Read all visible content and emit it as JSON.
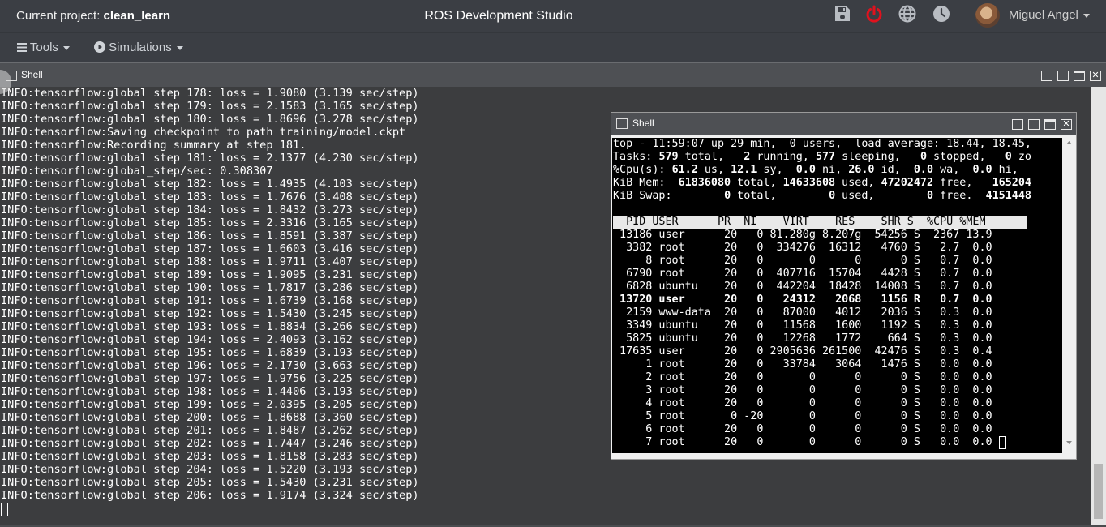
{
  "navbar": {
    "project_label": "Current project:",
    "project_name": "clean_learn",
    "title": "ROS Development Studio",
    "icons": [
      "save-icon",
      "power-icon",
      "globe-icon",
      "clock-icon"
    ],
    "user_name": "Miguel Angel",
    "power_color": "#e0121e"
  },
  "toolbar": {
    "tools_label": "Tools",
    "simulations_label": "Simulations"
  },
  "shell": {
    "title": "Shell",
    "log": "INFO:tensorflow:global step 178: loss = 1.9080 (3.139 sec/step)\nINFO:tensorflow:global step 179: loss = 2.1583 (3.165 sec/step)\nINFO:tensorflow:global step 180: loss = 1.8696 (3.278 sec/step)\nINFO:tensorflow:Saving checkpoint to path training/model.ckpt\nINFO:tensorflow:Recording summary at step 181.\nINFO:tensorflow:global step 181: loss = 2.1377 (4.230 sec/step)\nINFO:tensorflow:global_step/sec: 0.308307\nINFO:tensorflow:global step 182: loss = 1.4935 (4.103 sec/step)\nINFO:tensorflow:global step 183: loss = 1.7676 (3.408 sec/step)\nINFO:tensorflow:global step 184: loss = 1.8432 (3.273 sec/step)\nINFO:tensorflow:global step 185: loss = 2.3316 (3.165 sec/step)\nINFO:tensorflow:global step 186: loss = 1.8591 (3.387 sec/step)\nINFO:tensorflow:global step 187: loss = 1.6603 (3.416 sec/step)\nINFO:tensorflow:global step 188: loss = 1.9711 (3.407 sec/step)\nINFO:tensorflow:global step 189: loss = 1.9095 (3.231 sec/step)\nINFO:tensorflow:global step 190: loss = 1.7817 (3.286 sec/step)\nINFO:tensorflow:global step 191: loss = 1.6739 (3.168 sec/step)\nINFO:tensorflow:global step 192: loss = 1.5430 (3.245 sec/step)\nINFO:tensorflow:global step 193: loss = 1.8834 (3.266 sec/step)\nINFO:tensorflow:global step 194: loss = 2.4093 (3.162 sec/step)\nINFO:tensorflow:global step 195: loss = 1.6839 (3.193 sec/step)\nINFO:tensorflow:global step 196: loss = 2.1730 (3.663 sec/step)\nINFO:tensorflow:global step 197: loss = 1.9756 (3.225 sec/step)\nINFO:tensorflow:global step 198: loss = 1.4406 (3.193 sec/step)\nINFO:tensorflow:global step 199: loss = 2.0395 (3.205 sec/step)\nINFO:tensorflow:global step 200: loss = 1.8688 (3.360 sec/step)\nINFO:tensorflow:global step 201: loss = 1.8487 (3.262 sec/step)\nINFO:tensorflow:global step 202: loss = 1.7447 (3.246 sec/step)\nINFO:tensorflow:global step 203: loss = 1.8158 (3.283 sec/step)\nINFO:tensorflow:global step 204: loss = 1.5220 (3.193 sec/step)\nINFO:tensorflow:global step 205: loss = 1.5430 (3.231 sec/step)\nINFO:tensorflow:global step 206: loss = 1.9174 (3.324 sec/step)"
  },
  "inner_shell": {
    "title": "Shell",
    "summary": [
      [
        "top - 11:59:07 up 29 min,  0 users,  load average: 18.44, 18.45,"
      ],
      [
        "Tasks: ",
        "579",
        " total,   ",
        "2",
        " running, ",
        "577",
        " sleeping,   ",
        "0",
        " stopped,   ",
        "0",
        " zo"
      ],
      [
        "%Cpu(s): ",
        "61.2",
        " us, ",
        "12.1",
        " sy,  ",
        "0.0",
        " ni, ",
        "26.0",
        " id,  ",
        "0.0",
        " wa,  ",
        "0.0",
        " hi,"
      ],
      [
        "KiB Mem:  ",
        "61836080",
        " total, ",
        "14633608",
        " used, ",
        "47202472",
        " free,   ",
        "165204"
      ],
      [
        "KiB Swap:        ",
        "0",
        " total,        ",
        "0",
        " used,        ",
        "0",
        " free.  ",
        "4151448"
      ]
    ],
    "header": "  PID USER      PR  NI    VIRT    RES    SHR S  %CPU %MEM",
    "rows": [
      " 13186 user      20   0 81.280g 8.207g  54256 S  2367 13.9",
      "  3382 root      20   0  334276  16312   4760 S   2.7  0.0",
      "     8 root      20   0       0      0      0 S   0.7  0.0",
      "  6790 root      20   0  407716  15704   4428 S   0.7  0.0",
      "  6828 ubuntu    20   0  442204  18428  14008 S   0.7  0.0",
      " 13720 user      20   0   24312   2068   1156 R   0.7  0.0",
      "  2159 www-data  20   0   87000   4012   2036 S   0.3  0.0",
      "  3349 ubuntu    20   0   11568   1600   1192 S   0.3  0.0",
      "  5825 ubuntu    20   0   12268   1772    664 S   0.3  0.0",
      " 17635 user      20   0 2905636 261500  42476 S   0.3  0.4",
      "     1 root      20   0   33784   3064   1476 S   0.0  0.0",
      "     2 root      20   0       0      0      0 S   0.0  0.0",
      "     3 root      20   0       0      0      0 S   0.0  0.0",
      "     4 root      20   0       0      0      0 S   0.0  0.0",
      "     5 root       0 -20       0      0      0 S   0.0  0.0",
      "     6 root      20   0       0      0      0 S   0.0  0.0",
      "     7 root      20   0       0      0      0 S   0.0  0.0"
    ],
    "bold_row_index": 5
  }
}
